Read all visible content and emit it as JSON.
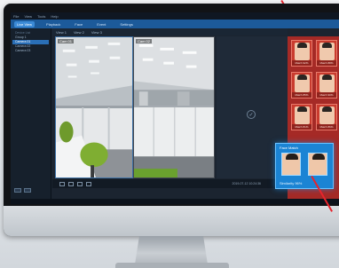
{
  "window": {
    "menu": [
      "File",
      "View",
      "Tools",
      "Help"
    ],
    "tabs": [
      {
        "label": "Live View",
        "active": true
      },
      {
        "label": "Playback",
        "active": false
      },
      {
        "label": "Face",
        "active": false
      },
      {
        "label": "Event",
        "active": false
      },
      {
        "label": "Settings",
        "active": false
      }
    ]
  },
  "sidebar": {
    "rows": [
      {
        "label": "Device List",
        "header": true
      },
      {
        "label": "Group 1",
        "selected": false
      },
      {
        "label": "Camera 01",
        "selected": true
      },
      {
        "label": "Camera 02",
        "selected": false
      },
      {
        "label": "Camera 03",
        "selected": false
      }
    ]
  },
  "viewbar": {
    "items": [
      "View 1",
      "View 2",
      "View 3"
    ]
  },
  "cameras": [
    {
      "label": "Cam 01"
    },
    {
      "label": "Cam 02"
    }
  ],
  "empty_pane_icon": "add-channel-icon",
  "ctrlbar": {
    "timestamp": "2019-07-12 10:24:36"
  },
  "alerts": {
    "cards": [
      {
        "caption": "Match 92%"
      },
      {
        "caption": "Match 88%"
      },
      {
        "caption": "Match 85%"
      },
      {
        "caption": "Match 90%"
      },
      {
        "caption": "Match 81%"
      },
      {
        "caption": "Match 86%"
      }
    ]
  },
  "popup": {
    "title": "Face Match",
    "match_text": "Similarity 96%"
  },
  "colors": {
    "accent": "#1b84d4",
    "alert": "#c93b2e",
    "tabbar": "#1c5a9a"
  }
}
